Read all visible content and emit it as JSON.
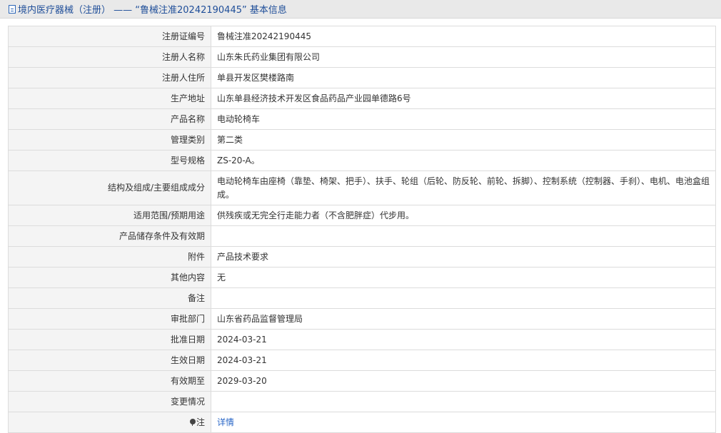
{
  "header": {
    "title": "境内医疗器械（注册） —— “鲁械注准20242190445” 基本信息"
  },
  "rows": [
    {
      "label": "注册证编号",
      "value": "鲁械注准20242190445"
    },
    {
      "label": "注册人名称",
      "value": "山东朱氏药业集团有限公司"
    },
    {
      "label": "注册人住所",
      "value": "单县开发区樊楼路南"
    },
    {
      "label": "生产地址",
      "value": "山东单县经济技术开发区食品药品产业园单德路6号"
    },
    {
      "label": "产品名称",
      "value": "电动轮椅车"
    },
    {
      "label": "管理类别",
      "value": "第二类"
    },
    {
      "label": "型号规格",
      "value": "ZS-20-A。"
    },
    {
      "label": "结构及组成/主要组成成分",
      "value": "电动轮椅车由座椅（靠垫、椅架、把手）、扶手、轮组（后轮、防反轮、前轮、拆脚）、控制系统（控制器、手刹）、电机、电池盒组成。"
    },
    {
      "label": "适用范围/预期用途",
      "value": "供残疾或无完全行走能力者（不含肥胖症）代步用。"
    },
    {
      "label": "产品储存条件及有效期",
      "value": ""
    },
    {
      "label": "附件",
      "value": "产品技术要求"
    },
    {
      "label": "其他内容",
      "value": "无"
    },
    {
      "label": "备注",
      "value": ""
    },
    {
      "label": "审批部门",
      "value": "山东省药品监督管理局"
    },
    {
      "label": "批准日期",
      "value": "2024-03-21"
    },
    {
      "label": "生效日期",
      "value": "2024-03-21"
    },
    {
      "label": "有效期至",
      "value": "2029-03-20"
    },
    {
      "label": "变更情况",
      "value": ""
    }
  ],
  "note": {
    "label": "注",
    "icon": "pin-icon",
    "link_text": "详情"
  }
}
